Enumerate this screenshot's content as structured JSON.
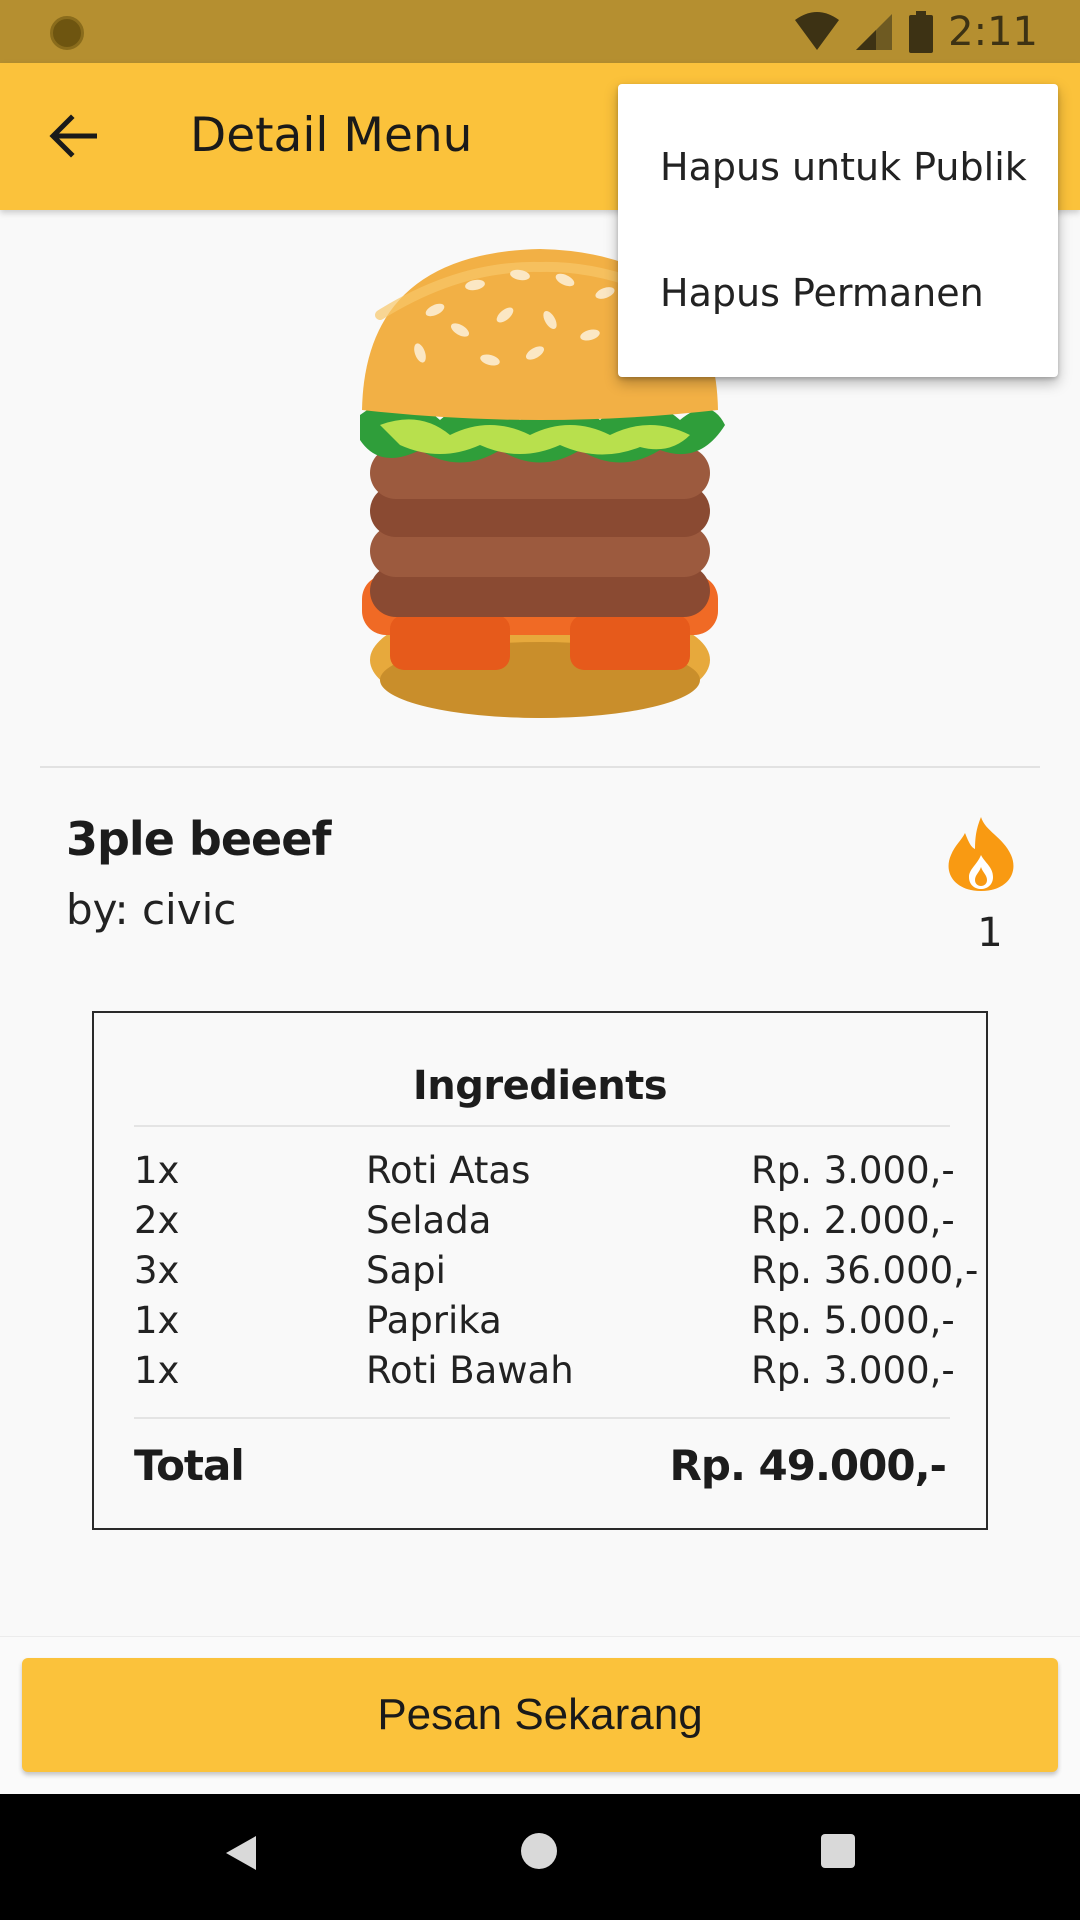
{
  "status_bar": {
    "time": "2:11"
  },
  "app_bar": {
    "title": "Detail Menu"
  },
  "menu": {
    "name": "3ple beeef",
    "author": "by: civic",
    "fire_count": "1"
  },
  "ingredients": {
    "title": "Ingredients",
    "rows": [
      {
        "qty": "1x",
        "name": "Roti Atas",
        "price": "Rp. 3.000,-"
      },
      {
        "qty": "2x",
        "name": "Selada",
        "price": "Rp. 2.000,-"
      },
      {
        "qty": "3x",
        "name": "Sapi",
        "price": "Rp. 36.000,-"
      },
      {
        "qty": "1x",
        "name": "Paprika",
        "price": "Rp. 5.000,-"
      },
      {
        "qty": "1x",
        "name": "Roti Bawah",
        "price": "Rp. 3.000,-"
      }
    ],
    "total_label": "Total",
    "total_value": "Rp. 49.000,-"
  },
  "order_button": {
    "label": "Pesan Sekarang"
  },
  "popup_menu": {
    "items": [
      {
        "label": "Hapus untuk Publik"
      },
      {
        "label": "Hapus Permanen"
      }
    ]
  },
  "colors": {
    "accent": "#fbc23b",
    "status_bar": "#b58f30",
    "fire": "#f99a12"
  },
  "icons": [
    "back-arrow-icon",
    "wifi-icon",
    "signal-icon",
    "battery-icon",
    "fire-icon",
    "nav-back-icon",
    "nav-home-icon",
    "nav-recents-icon"
  ]
}
